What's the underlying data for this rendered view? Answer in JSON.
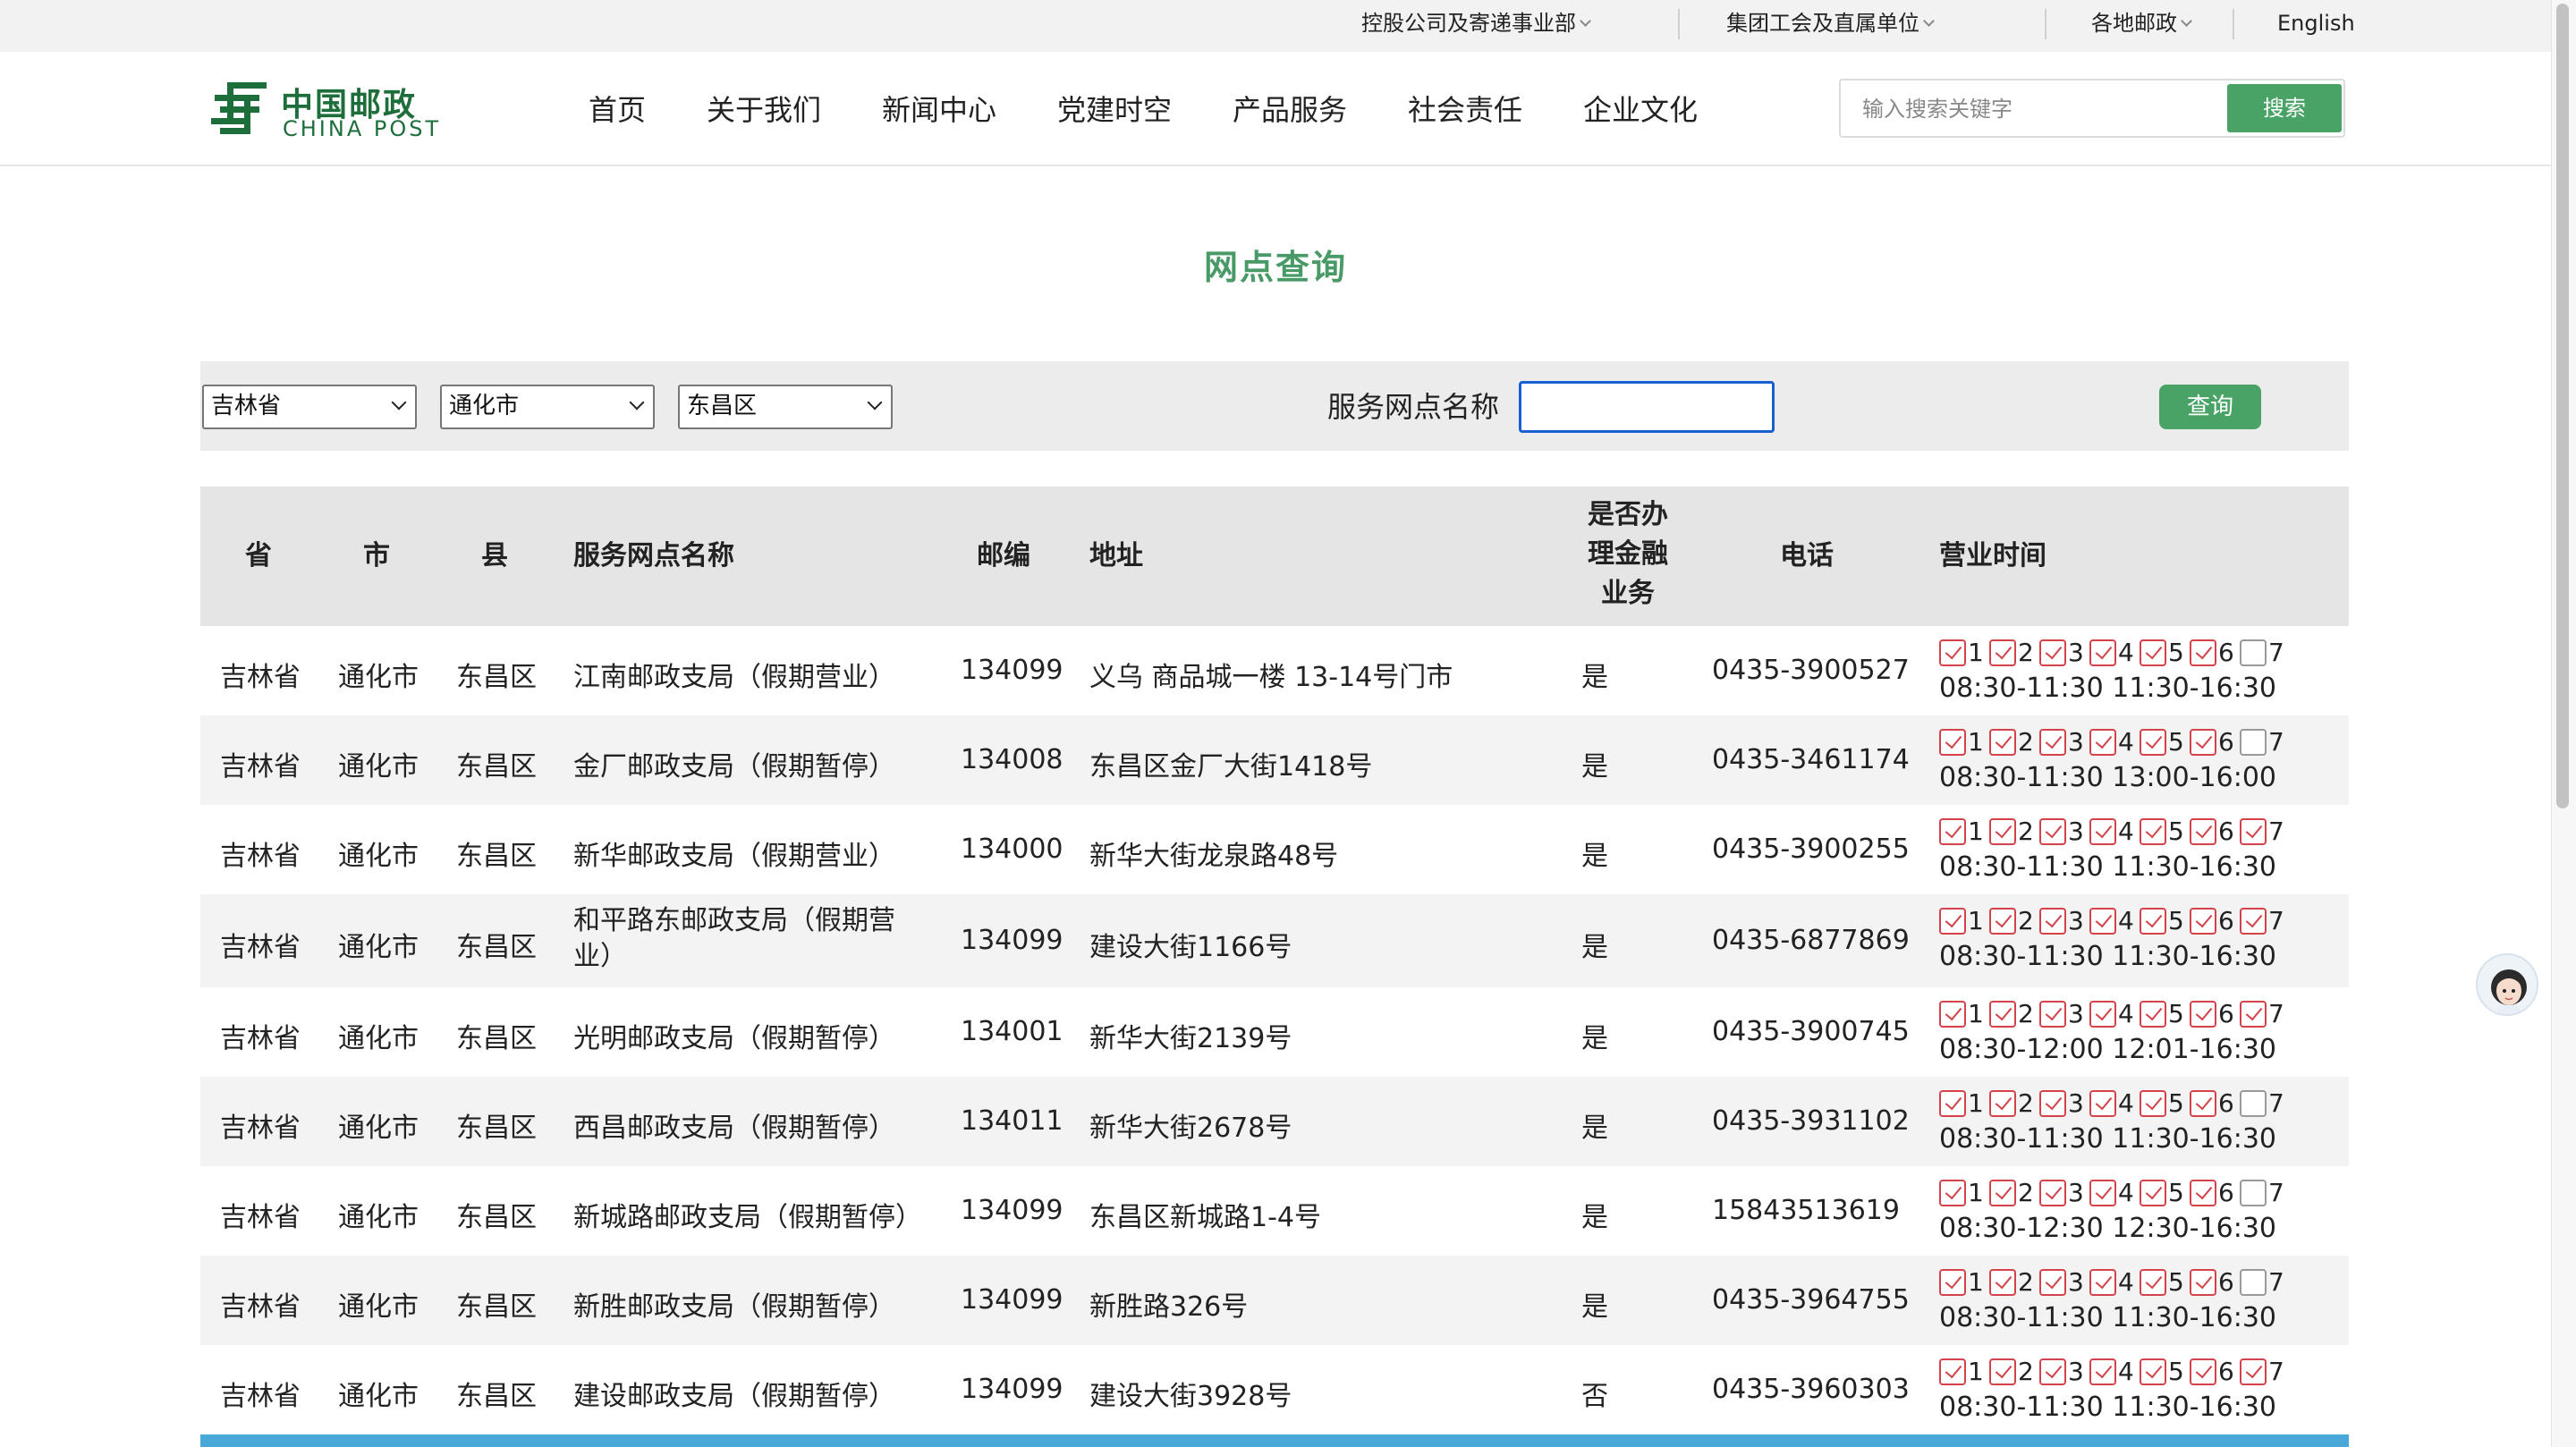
{
  "topbar": {
    "links": [
      "控股公司及寄递事业部",
      "集团工会及直属单位",
      "各地邮政"
    ],
    "english": "English"
  },
  "logo": {
    "cn": "中国邮政",
    "en": "CHINA POST"
  },
  "nav": [
    "首页",
    "关于我们",
    "新闻中心",
    "党建时空",
    "产品服务",
    "社会责任",
    "企业文化"
  ],
  "search": {
    "placeholder": "输入搜索关键字",
    "button": "搜索"
  },
  "page_title": "网点查询",
  "filter": {
    "province": "吉林省",
    "city": "通化市",
    "district": "东昌区",
    "name_label": "服务网点名称",
    "name_value": "",
    "query_button": "查询"
  },
  "table": {
    "headers": [
      "省",
      "市",
      "县",
      "服务网点名称",
      "邮编",
      "地址",
      "是否办理金融业务",
      "电话",
      "营业时间"
    ],
    "rows": [
      {
        "province": "吉林省",
        "city": "通化市",
        "county": "东昌区",
        "name": "江南邮政支局（假期营业）",
        "zip": "134099",
        "address": "义乌 商品城一楼 13-14号门市",
        "finance": "是",
        "phone": "0435-3900527",
        "days": [
          true,
          true,
          true,
          true,
          true,
          true,
          false
        ],
        "hours": "08:30-11:30 11:30-16:30"
      },
      {
        "province": "吉林省",
        "city": "通化市",
        "county": "东昌区",
        "name": "金厂邮政支局（假期暂停）",
        "zip": "134008",
        "address": "东昌区金厂大街1418号",
        "finance": "是",
        "phone": "0435-3461174",
        "days": [
          true,
          true,
          true,
          true,
          true,
          true,
          false
        ],
        "hours": "08:30-11:30 13:00-16:00"
      },
      {
        "province": "吉林省",
        "city": "通化市",
        "county": "东昌区",
        "name": "新华邮政支局（假期营业）",
        "zip": "134000",
        "address": "新华大街龙泉路48号",
        "finance": "是",
        "phone": "0435-3900255",
        "days": [
          true,
          true,
          true,
          true,
          true,
          true,
          true
        ],
        "hours": "08:30-11:30 11:30-16:30"
      },
      {
        "province": "吉林省",
        "city": "通化市",
        "county": "东昌区",
        "name": "和平路东邮政支局（假期营业）",
        "zip": "134099",
        "address": "建设大街1166号",
        "finance": "是",
        "phone": "0435-6877869",
        "days": [
          true,
          true,
          true,
          true,
          true,
          true,
          true
        ],
        "hours": "08:30-11:30 11:30-16:30"
      },
      {
        "province": "吉林省",
        "city": "通化市",
        "county": "东昌区",
        "name": "光明邮政支局（假期暂停）",
        "zip": "134001",
        "address": "新华大街2139号",
        "finance": "是",
        "phone": "0435-3900745",
        "days": [
          true,
          true,
          true,
          true,
          true,
          true,
          true
        ],
        "hours": "08:30-12:00 12:01-16:30"
      },
      {
        "province": "吉林省",
        "city": "通化市",
        "county": "东昌区",
        "name": "西昌邮政支局（假期暂停）",
        "zip": "134011",
        "address": "新华大街2678号",
        "finance": "是",
        "phone": "0435-3931102",
        "days": [
          true,
          true,
          true,
          true,
          true,
          true,
          false
        ],
        "hours": "08:30-11:30 11:30-16:30"
      },
      {
        "province": "吉林省",
        "city": "通化市",
        "county": "东昌区",
        "name": "新城路邮政支局（假期暂停）",
        "zip": "134099",
        "address": "东昌区新城路1-4号",
        "finance": "是",
        "phone": "15843513619",
        "days": [
          true,
          true,
          true,
          true,
          true,
          true,
          false
        ],
        "hours": "08:30-12:30 12:30-16:30"
      },
      {
        "province": "吉林省",
        "city": "通化市",
        "county": "东昌区",
        "name": "新胜邮政支局（假期暂停）",
        "zip": "134099",
        "address": "新胜路326号",
        "finance": "是",
        "phone": "0435-3964755",
        "days": [
          true,
          true,
          true,
          true,
          true,
          true,
          false
        ],
        "hours": "08:30-11:30 11:30-16:30"
      },
      {
        "province": "吉林省",
        "city": "通化市",
        "county": "东昌区",
        "name": "建设邮政支局（假期暂停）",
        "zip": "134099",
        "address": "建设大街3928号",
        "finance": "否",
        "phone": "0435-3960303",
        "days": [
          true,
          true,
          true,
          true,
          true,
          true,
          true
        ],
        "hours": "08:30-11:30 11:30-16:30"
      }
    ]
  },
  "colors": {
    "brand_green": "#1e6e3c",
    "button_green": "#4aa366",
    "title_green": "#4a9a68",
    "check_red": "#d4424a",
    "footer_blue": "#4aa8d8"
  },
  "icons": [
    "china-post-logo-icon",
    "chevron-down-icon",
    "checkbox-icon",
    "assistant-avatar-icon"
  ]
}
